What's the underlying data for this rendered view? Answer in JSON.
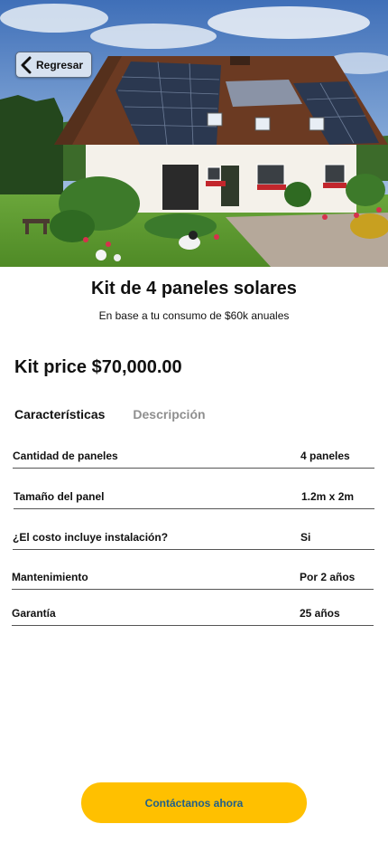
{
  "header": {
    "back_label": "Regresar"
  },
  "product": {
    "title": "Kit de 4 paneles solares",
    "subtitle": "En base a tu consumo de $60k anuales",
    "price": "Kit price $70,000.00"
  },
  "tabs": [
    {
      "label": "Características",
      "active": true
    },
    {
      "label": "Descripción",
      "active": false
    }
  ],
  "specs": [
    {
      "label": "Cantidad de paneles",
      "value": "4 paneles"
    },
    {
      "label": "Tamaño del panel",
      "value": "1.2m x 2m"
    },
    {
      "label": "¿El costo incluye instalación?",
      "value": "Si"
    },
    {
      "label": "Mantenimiento",
      "value": "Por 2 años"
    },
    {
      "label": "Garantía",
      "value": "25 años"
    }
  ],
  "cta": {
    "label": "Contáctanos ahora"
  },
  "colors": {
    "accent": "#ffc000",
    "cta_text": "#1f5f8a",
    "inactive_tab": "#8f8f8f"
  },
  "icons": {
    "back": "chevron-left-icon"
  }
}
